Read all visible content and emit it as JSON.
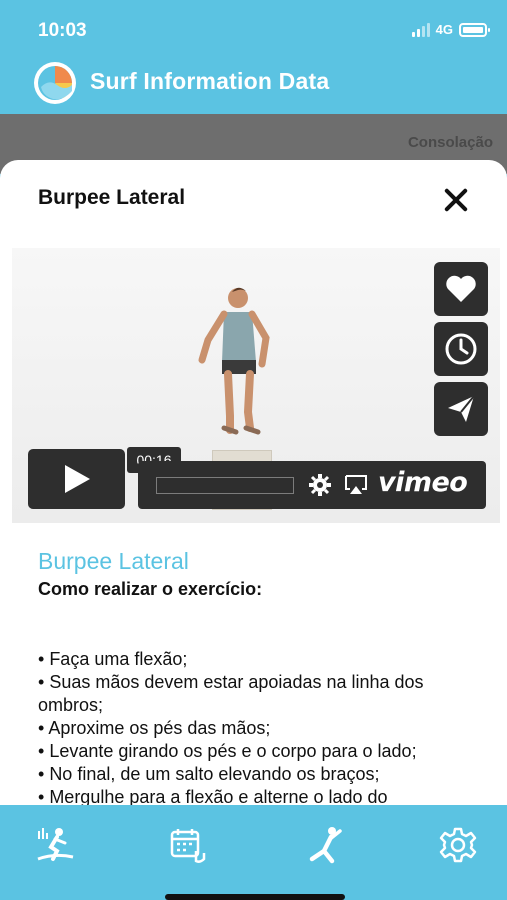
{
  "status": {
    "time": "10:03",
    "network": "4G"
  },
  "app": {
    "title": "Surf Information Data"
  },
  "background": {
    "text": "Consolação"
  },
  "modal": {
    "title": "Burpee Lateral"
  },
  "video": {
    "time_tooltip": "00:16",
    "brand": "vimeo",
    "progress": 0.0
  },
  "exercise": {
    "title": "Burpee Lateral",
    "subtitle": "Como realizar o exercício:",
    "steps": [
      "Faça uma flexão;",
      "Suas mãos devem estar apoiadas na linha dos ombros;",
      "Aproxime os pés das mãos;",
      "Levante girando os pés e o corpo para o lado;",
      "No final, de um salto elevando os braços;",
      "Mergulhe para a flexão e alterne o lado do"
    ]
  },
  "colors": {
    "accent": "#5bc3e2",
    "dark": "#2e2e2e"
  },
  "tabs": [
    "surf-icon",
    "calendar-icon",
    "stretching-icon",
    "gear-icon"
  ]
}
